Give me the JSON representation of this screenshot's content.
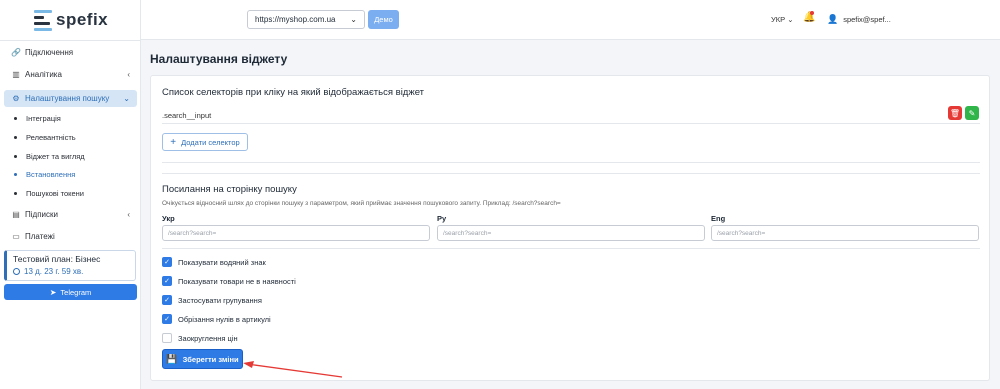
{
  "logo": {
    "text": "spefix"
  },
  "sidebar": {
    "items": [
      {
        "label": "Підключення",
        "icon": "link-icon"
      },
      {
        "label": "Аналітика",
        "icon": "chart-icon"
      },
      {
        "label": "Налаштування пошуку",
        "icon": "gear-icon"
      },
      {
        "label": "Підписки",
        "icon": "subscription-icon"
      },
      {
        "label": "Платежі",
        "icon": "payment-icon"
      }
    ],
    "subitems": [
      "Інтеграція",
      "Релевантність",
      "Віджет та вигляд",
      "Встановлення",
      "Пошукові токени"
    ],
    "plan_title": "Тестовий план: Бізнес",
    "plan_time": "13 д. 23 г. 59 хв.",
    "telegram_label": "Telegram"
  },
  "header": {
    "site": "https://myshop.com.ua",
    "demo_label": "Демо",
    "language": "УКР",
    "user": "spefix@spef..."
  },
  "page": {
    "title": "Налаштування віджету"
  },
  "selectors": {
    "title": "Список селекторів при кліку на який відображається віджет",
    "items": [
      ".search__input"
    ],
    "add_label": "Додати селектор"
  },
  "search_page": {
    "title": "Посилання на сторінку пошуку",
    "hint": "Очікується відносний шлях до сторінки пошуку з параметром, який приймає значення пошукового запиту. Приклад: /search?search=",
    "fields": [
      {
        "label": "Укр",
        "placeholder": "/search?search="
      },
      {
        "label": "Ру",
        "placeholder": "/search?search="
      },
      {
        "label": "Eng",
        "placeholder": "/search?search="
      }
    ]
  },
  "options": [
    {
      "label": "Показувати водяний знак",
      "checked": true
    },
    {
      "label": "Показувати товари не в наявності",
      "checked": true
    },
    {
      "label": "Застосувати групування",
      "checked": true
    },
    {
      "label": "Обрізання нулів в артикулі",
      "checked": true
    },
    {
      "label": "Заокруглення цін",
      "checked": false
    }
  ],
  "save_label": "Зберегти зміни",
  "colors": {
    "accent": "#2e7be6",
    "danger": "#e53935",
    "success": "#2fb54a",
    "annotation": "#e53935"
  }
}
